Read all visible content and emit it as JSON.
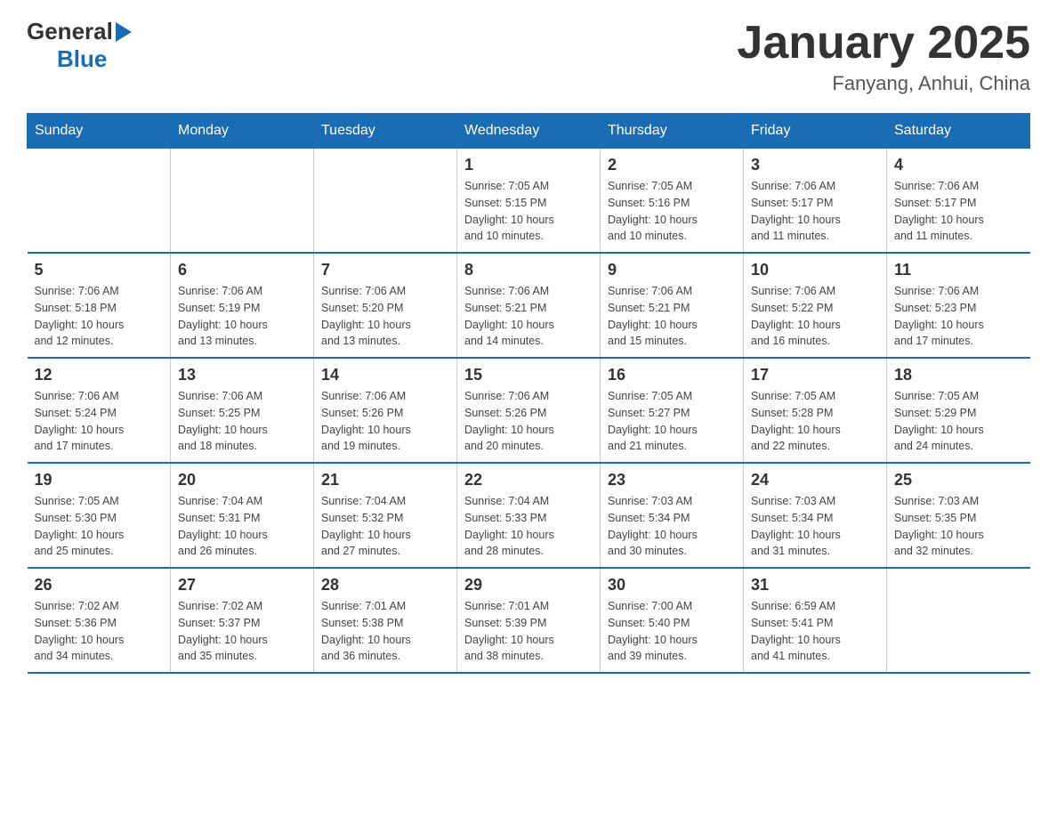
{
  "header": {
    "logo_general": "General",
    "logo_blue": "Blue",
    "title": "January 2025",
    "subtitle": "Fanyang, Anhui, China"
  },
  "days_of_week": [
    "Sunday",
    "Monday",
    "Tuesday",
    "Wednesday",
    "Thursday",
    "Friday",
    "Saturday"
  ],
  "weeks": [
    [
      {
        "day": "",
        "info": ""
      },
      {
        "day": "",
        "info": ""
      },
      {
        "day": "",
        "info": ""
      },
      {
        "day": "1",
        "info": "Sunrise: 7:05 AM\nSunset: 5:15 PM\nDaylight: 10 hours\nand 10 minutes."
      },
      {
        "day": "2",
        "info": "Sunrise: 7:05 AM\nSunset: 5:16 PM\nDaylight: 10 hours\nand 10 minutes."
      },
      {
        "day": "3",
        "info": "Sunrise: 7:06 AM\nSunset: 5:17 PM\nDaylight: 10 hours\nand 11 minutes."
      },
      {
        "day": "4",
        "info": "Sunrise: 7:06 AM\nSunset: 5:17 PM\nDaylight: 10 hours\nand 11 minutes."
      }
    ],
    [
      {
        "day": "5",
        "info": "Sunrise: 7:06 AM\nSunset: 5:18 PM\nDaylight: 10 hours\nand 12 minutes."
      },
      {
        "day": "6",
        "info": "Sunrise: 7:06 AM\nSunset: 5:19 PM\nDaylight: 10 hours\nand 13 minutes."
      },
      {
        "day": "7",
        "info": "Sunrise: 7:06 AM\nSunset: 5:20 PM\nDaylight: 10 hours\nand 13 minutes."
      },
      {
        "day": "8",
        "info": "Sunrise: 7:06 AM\nSunset: 5:21 PM\nDaylight: 10 hours\nand 14 minutes."
      },
      {
        "day": "9",
        "info": "Sunrise: 7:06 AM\nSunset: 5:21 PM\nDaylight: 10 hours\nand 15 minutes."
      },
      {
        "day": "10",
        "info": "Sunrise: 7:06 AM\nSunset: 5:22 PM\nDaylight: 10 hours\nand 16 minutes."
      },
      {
        "day": "11",
        "info": "Sunrise: 7:06 AM\nSunset: 5:23 PM\nDaylight: 10 hours\nand 17 minutes."
      }
    ],
    [
      {
        "day": "12",
        "info": "Sunrise: 7:06 AM\nSunset: 5:24 PM\nDaylight: 10 hours\nand 17 minutes."
      },
      {
        "day": "13",
        "info": "Sunrise: 7:06 AM\nSunset: 5:25 PM\nDaylight: 10 hours\nand 18 minutes."
      },
      {
        "day": "14",
        "info": "Sunrise: 7:06 AM\nSunset: 5:26 PM\nDaylight: 10 hours\nand 19 minutes."
      },
      {
        "day": "15",
        "info": "Sunrise: 7:06 AM\nSunset: 5:26 PM\nDaylight: 10 hours\nand 20 minutes."
      },
      {
        "day": "16",
        "info": "Sunrise: 7:05 AM\nSunset: 5:27 PM\nDaylight: 10 hours\nand 21 minutes."
      },
      {
        "day": "17",
        "info": "Sunrise: 7:05 AM\nSunset: 5:28 PM\nDaylight: 10 hours\nand 22 minutes."
      },
      {
        "day": "18",
        "info": "Sunrise: 7:05 AM\nSunset: 5:29 PM\nDaylight: 10 hours\nand 24 minutes."
      }
    ],
    [
      {
        "day": "19",
        "info": "Sunrise: 7:05 AM\nSunset: 5:30 PM\nDaylight: 10 hours\nand 25 minutes."
      },
      {
        "day": "20",
        "info": "Sunrise: 7:04 AM\nSunset: 5:31 PM\nDaylight: 10 hours\nand 26 minutes."
      },
      {
        "day": "21",
        "info": "Sunrise: 7:04 AM\nSunset: 5:32 PM\nDaylight: 10 hours\nand 27 minutes."
      },
      {
        "day": "22",
        "info": "Sunrise: 7:04 AM\nSunset: 5:33 PM\nDaylight: 10 hours\nand 28 minutes."
      },
      {
        "day": "23",
        "info": "Sunrise: 7:03 AM\nSunset: 5:34 PM\nDaylight: 10 hours\nand 30 minutes."
      },
      {
        "day": "24",
        "info": "Sunrise: 7:03 AM\nSunset: 5:34 PM\nDaylight: 10 hours\nand 31 minutes."
      },
      {
        "day": "25",
        "info": "Sunrise: 7:03 AM\nSunset: 5:35 PM\nDaylight: 10 hours\nand 32 minutes."
      }
    ],
    [
      {
        "day": "26",
        "info": "Sunrise: 7:02 AM\nSunset: 5:36 PM\nDaylight: 10 hours\nand 34 minutes."
      },
      {
        "day": "27",
        "info": "Sunrise: 7:02 AM\nSunset: 5:37 PM\nDaylight: 10 hours\nand 35 minutes."
      },
      {
        "day": "28",
        "info": "Sunrise: 7:01 AM\nSunset: 5:38 PM\nDaylight: 10 hours\nand 36 minutes."
      },
      {
        "day": "29",
        "info": "Sunrise: 7:01 AM\nSunset: 5:39 PM\nDaylight: 10 hours\nand 38 minutes."
      },
      {
        "day": "30",
        "info": "Sunrise: 7:00 AM\nSunset: 5:40 PM\nDaylight: 10 hours\nand 39 minutes."
      },
      {
        "day": "31",
        "info": "Sunrise: 6:59 AM\nSunset: 5:41 PM\nDaylight: 10 hours\nand 41 minutes."
      },
      {
        "day": "",
        "info": ""
      }
    ]
  ]
}
